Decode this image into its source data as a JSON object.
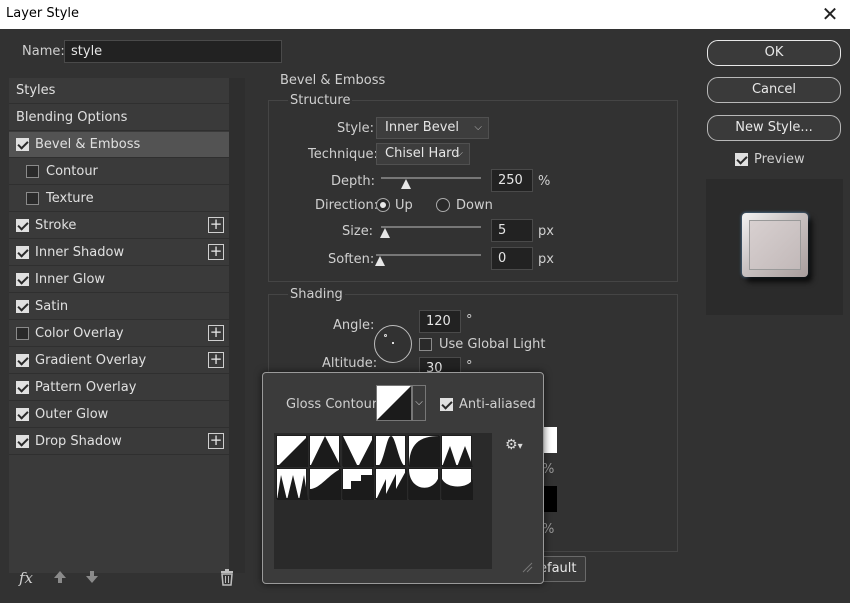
{
  "window": {
    "title": "Layer Style",
    "close_glyph": "✕"
  },
  "name_field": {
    "label": "Name:",
    "value": "style"
  },
  "buttons": {
    "ok": "OK",
    "cancel": "Cancel",
    "new_style": "New Style...",
    "default_partial": "efault"
  },
  "preview": {
    "label": "Preview",
    "checked": true
  },
  "styles_list": [
    {
      "label": "Styles",
      "header": true
    },
    {
      "label": "Blending Options",
      "header": true
    },
    {
      "label": "Bevel & Emboss",
      "checked": true,
      "selected": true,
      "plus": false
    },
    {
      "label": "Contour",
      "checked": false,
      "indent": true,
      "plus": false
    },
    {
      "label": "Texture",
      "checked": false,
      "indent": true,
      "plus": false
    },
    {
      "label": "Stroke",
      "checked": true,
      "plus": true
    },
    {
      "label": "Inner Shadow",
      "checked": true,
      "plus": true
    },
    {
      "label": "Inner Glow",
      "checked": true,
      "plus": false
    },
    {
      "label": "Satin",
      "checked": true,
      "plus": false
    },
    {
      "label": "Color Overlay",
      "checked": false,
      "plus": true
    },
    {
      "label": "Gradient Overlay",
      "checked": true,
      "plus": true
    },
    {
      "label": "Pattern Overlay",
      "checked": true,
      "plus": false
    },
    {
      "label": "Outer Glow",
      "checked": true,
      "plus": false
    },
    {
      "label": "Drop Shadow",
      "checked": true,
      "plus": true
    }
  ],
  "footer": {
    "fx": "fx",
    "icons": [
      "fx-icon",
      "move-up-icon",
      "move-down-icon",
      "trash-icon"
    ]
  },
  "bevel": {
    "heading": "Bevel & Emboss",
    "structure": {
      "heading": "Structure",
      "style_label": "Style:",
      "style_value": "Inner Bevel",
      "technique_label": "Technique:",
      "technique_value": "Chisel Hard",
      "depth_label": "Depth:",
      "depth_value": "250",
      "depth_unit": "%",
      "direction_label": "Direction:",
      "direction_up": "Up",
      "direction_down": "Down",
      "direction_selected": "Up",
      "size_label": "Size:",
      "size_value": "5",
      "size_unit": "px",
      "soften_label": "Soften:",
      "soften_value": "0",
      "soften_unit": "px"
    },
    "shading": {
      "heading": "Shading",
      "angle_label": "Angle:",
      "angle_value": "120",
      "angle_unit": "°",
      "global_light_label": "Use Global Light",
      "global_light_checked": false,
      "altitude_label": "Altitude:",
      "altitude_value": "30",
      "altitude_unit": "°",
      "pct1": "%",
      "pct2": "%"
    }
  },
  "gloss_popup": {
    "label": "Gloss Contour:",
    "anti_aliased_label": "Anti-aliased",
    "anti_aliased_checked": true,
    "gear_glyph": "⚙",
    "contours": [
      "linear",
      "cone",
      "cone-inverted",
      "gaussian",
      "half-round",
      "ring",
      "ring-double",
      "rolling-slope",
      "rounded-steps",
      "sawtooth",
      "cove-deep",
      "cove-shallow"
    ]
  },
  "colors": {
    "dialog_bg": "#323232",
    "panel_bg": "#3a3a3a",
    "selected_bg": "#535353",
    "text": "#e0e0e0"
  }
}
